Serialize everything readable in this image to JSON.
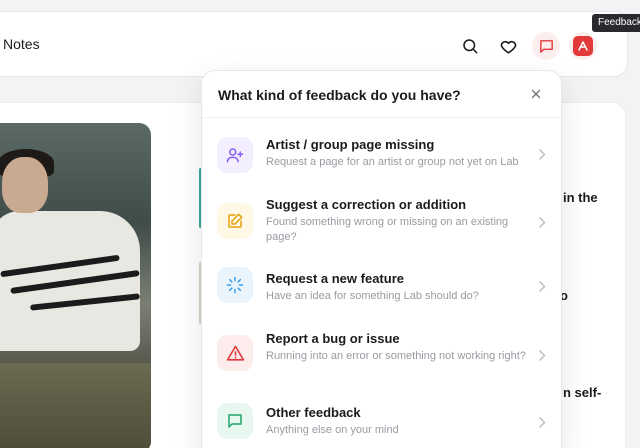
{
  "topbar": {
    "title": "Notes",
    "icons": [
      "search-icon",
      "heart-icon",
      "message-square-icon",
      "app-logo-icon"
    ]
  },
  "tooltip": {
    "text": "Feedback"
  },
  "background_text": {
    "line1": "in the",
    "line2": "o",
    "line3": "n self-"
  },
  "modal": {
    "title": "What kind of feedback do you have?",
    "close_icon": "close-icon",
    "options": [
      {
        "title": "Artist / group page missing",
        "description": "Request a page for an artist or group not yet on Lab",
        "icon": "user-plus-icon",
        "color": "#8b5cf6",
        "bg": "#f3efff"
      },
      {
        "title": "Suggest a correction or addition",
        "description": "Found something wrong or missing on an existing page?",
        "icon": "edit-icon",
        "color": "#e0a20a",
        "bg": "#fff8e4"
      },
      {
        "title": "Request a new feature",
        "description": "Have an idea for something Lab should do?",
        "icon": "loader-icon",
        "color": "#3b9be6",
        "bg": "#eaf4fd"
      },
      {
        "title": "Report a bug or issue",
        "description": "Running into an error or something not working right?",
        "icon": "alert-triangle-icon",
        "color": "#e23a3a",
        "bg": "#fdecec"
      },
      {
        "title": "Other feedback",
        "description": "Anything else on your mind",
        "icon": "message-square-icon",
        "color": "#22a36b",
        "bg": "#e8f7ef"
      }
    ]
  },
  "colors": {
    "brand": "#e23a3a",
    "page_bg": "#f3f3f5",
    "muted_text": "#9a9aa2"
  }
}
